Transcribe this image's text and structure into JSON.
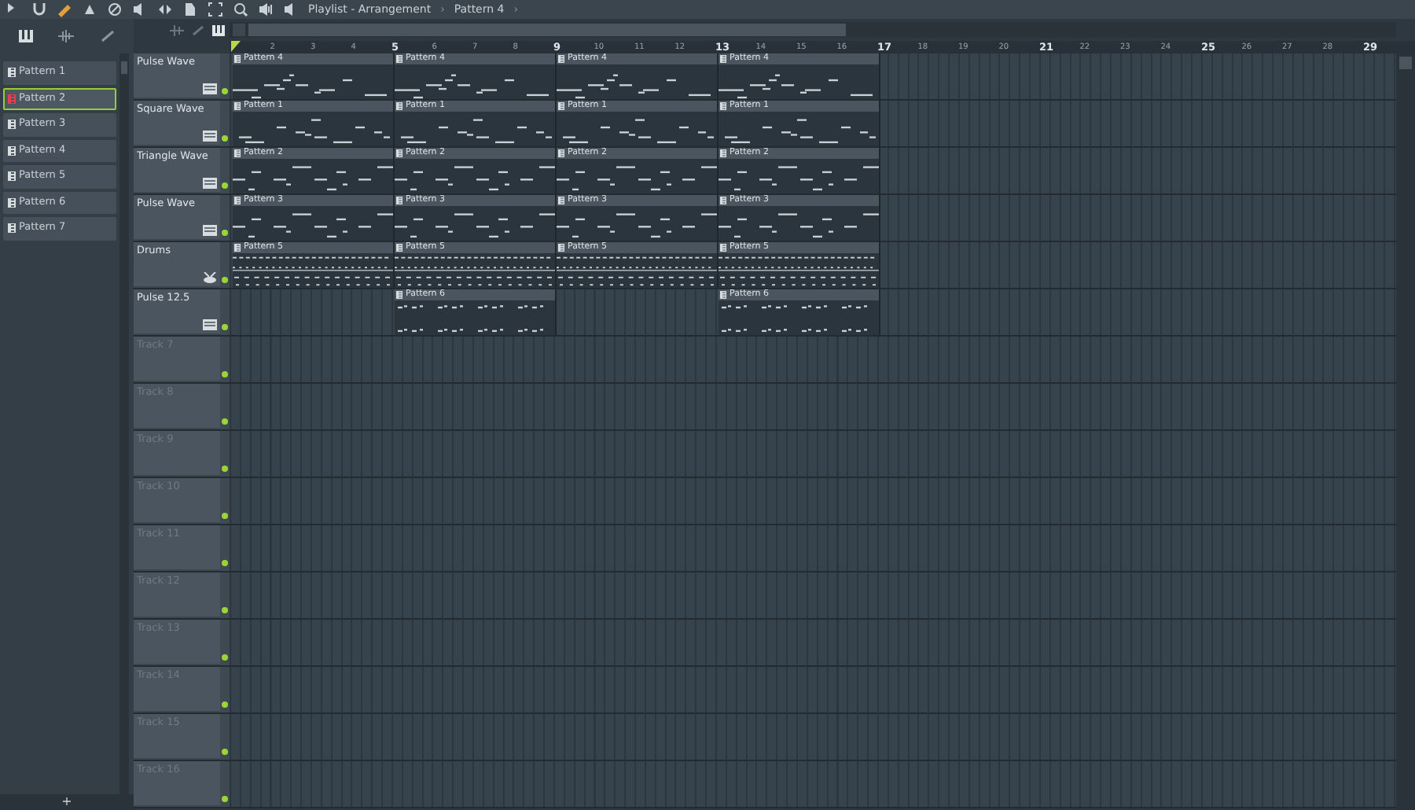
{
  "title_bar": {
    "window": "Playlist - Arrangement",
    "pattern": "Pattern 4",
    "separator": "›"
  },
  "patterns": [
    {
      "label": "Pattern 1",
      "selected": false
    },
    {
      "label": "Pattern 2",
      "selected": true
    },
    {
      "label": "Pattern 3",
      "selected": false
    },
    {
      "label": "Pattern 4",
      "selected": false
    },
    {
      "label": "Pattern 5",
      "selected": false
    },
    {
      "label": "Pattern 6",
      "selected": false
    },
    {
      "label": "Pattern 7",
      "selected": false
    }
  ],
  "ruler": [
    "2",
    "3",
    "4",
    "5",
    "6",
    "7",
    "8",
    "9",
    "10",
    "11",
    "12",
    "13",
    "14",
    "15",
    "16",
    "17",
    "18",
    "19",
    "20",
    "21",
    "22",
    "23",
    "24",
    "25",
    "26",
    "27",
    "28",
    "29"
  ],
  "tracks": [
    {
      "name": "Pulse Wave",
      "kind": "instrument",
      "on": true,
      "clips": [
        "Pattern 4",
        "Pattern 4",
        "Pattern 4",
        "Pattern 4"
      ]
    },
    {
      "name": "Square Wave",
      "kind": "instrument",
      "on": true,
      "clips": [
        "Pattern 1",
        "Pattern 1",
        "Pattern 1",
        "Pattern 1"
      ]
    },
    {
      "name": "Triangle Wave",
      "kind": "instrument",
      "on": true,
      "clips": [
        "Pattern 2",
        "Pattern 2",
        "Pattern 2",
        "Pattern 2"
      ]
    },
    {
      "name": "Pulse Wave",
      "kind": "instrument",
      "on": true,
      "clips": [
        "Pattern 3",
        "Pattern 3",
        "Pattern 3",
        "Pattern 3"
      ]
    },
    {
      "name": "Drums",
      "kind": "drums",
      "on": true,
      "clips": [
        "Pattern 5",
        "Pattern 5",
        "Pattern 5",
        "Pattern 5"
      ]
    },
    {
      "name": "Pulse 12.5",
      "kind": "instrument",
      "on": true,
      "clips": [
        {
          "kind": "gap"
        },
        {
          "kind": "clip",
          "label": "Pattern 6"
        },
        {
          "kind": "gap"
        },
        {
          "kind": "clip",
          "label": "Pattern 6"
        }
      ]
    },
    {
      "name": "Track 7",
      "kind": "empty",
      "on": true
    },
    {
      "name": "Track 8",
      "kind": "empty",
      "on": true
    },
    {
      "name": "Track 9",
      "kind": "empty",
      "on": true
    },
    {
      "name": "Track 10",
      "kind": "empty",
      "on": true
    },
    {
      "name": "Track 11",
      "kind": "empty",
      "on": true
    },
    {
      "name": "Track 12",
      "kind": "empty",
      "on": true
    },
    {
      "name": "Track 13",
      "kind": "empty",
      "on": true
    },
    {
      "name": "Track 14",
      "kind": "empty",
      "on": true
    },
    {
      "name": "Track 15",
      "kind": "empty",
      "on": true
    },
    {
      "name": "Track 16",
      "kind": "empty",
      "on": true
    }
  ],
  "add_button": "+"
}
